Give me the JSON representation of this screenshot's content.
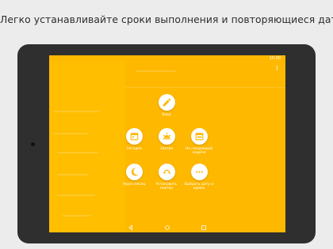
{
  "headline": "Легко устанавливайте сроки выполнения и повторяющиеся даты",
  "device": {
    "status_time": "10:00"
  },
  "edit_option": {
    "label": "Ввод",
    "icon": "pencil-icon"
  },
  "options": [
    {
      "id": "today",
      "label": "Сегодня",
      "icon": "calendar-icon"
    },
    {
      "id": "tomorrow",
      "label": "Завтра",
      "icon": "sunrise-icon"
    },
    {
      "id": "next-week",
      "label": "На следующей неделе",
      "icon": "calendar-week-icon"
    },
    {
      "id": "next-month",
      "label": "Через месяц",
      "icon": "moon-icon"
    },
    {
      "id": "repeat",
      "label": "Установить повтор",
      "icon": "repeat-icon"
    },
    {
      "id": "pick-date",
      "label": "Выбрать дату и время",
      "icon": "more-dots-icon"
    }
  ],
  "navbar": {
    "back": "back-icon",
    "home": "home-icon",
    "recents": "recents-icon"
  },
  "colors": {
    "accent": "#ffb800",
    "icon": "#ffb800",
    "bezel": "#2f2f2f"
  }
}
